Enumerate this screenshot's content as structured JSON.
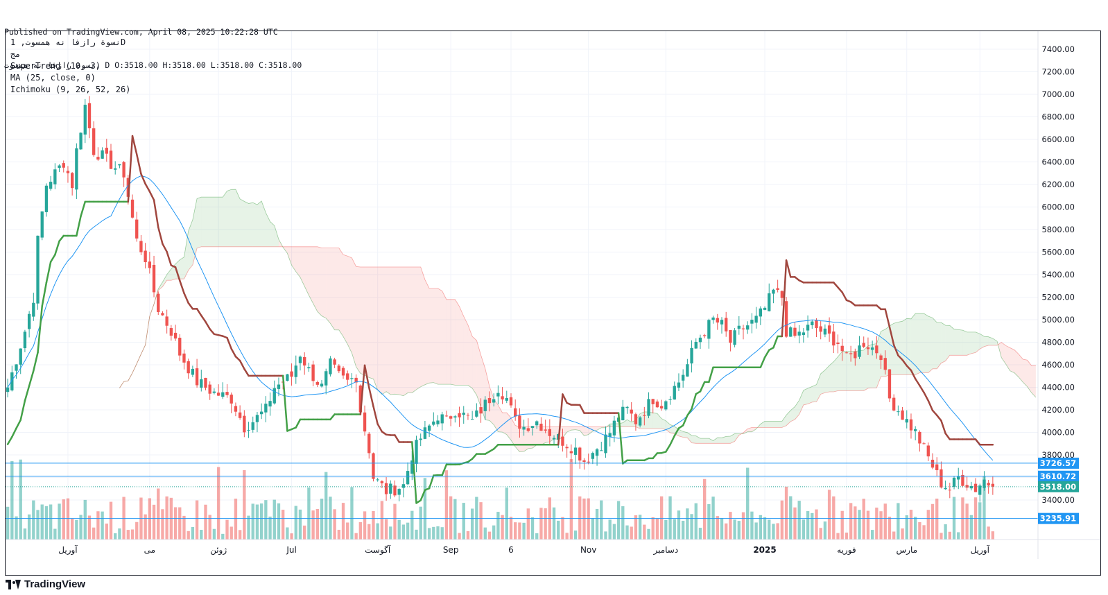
{
  "header": {
    "published": "Published on TradingView.com, April 08, 2025 10:22:28 UTC",
    "ohlc_line": "نسوة رازفا نه همسوت, D O:3518.00 H:3518.00 L:3518.00 C:3518.00"
  },
  "legend": {
    "symbol": "نسوة رازفا نه همسوت, 1D",
    "extra": "مج",
    "supertrend": "SuperTrend (10, 3)",
    "ma": "MA (25, close, 0)",
    "ichimoku": "Ichimoku (9, 26, 52, 26)"
  },
  "footer": {
    "logo_text": "TradingView"
  },
  "colors": {
    "up": "#26a69a",
    "down": "#ef5350",
    "supertrend_up": "#43a047",
    "supertrend_down": "#a0463e",
    "ma": "#2196f3",
    "cloud_up": "#43a047",
    "cloud_down": "#ef5350",
    "hline": "#2196f3",
    "last_price": "#26a69a"
  },
  "chart_data": {
    "type": "candlestick",
    "y_axis": {
      "min": 3200,
      "max": 7500,
      "scale": "linear",
      "ticks": [
        3400,
        3600,
        3800,
        4000,
        4200,
        4400,
        4600,
        4800,
        5000,
        5200,
        5400,
        5600,
        5800,
        6000,
        6200,
        6400,
        6600,
        6800,
        7000,
        7200,
        7400
      ],
      "tick_labels": [
        "3400.00",
        "3600.00",
        "3800.00",
        "4000.00",
        "4200.00",
        "4400.00",
        "4600.00",
        "4800.00",
        "5000.00",
        "5200.00",
        "5400.00",
        "5600.00",
        "5800.00",
        "6000.00",
        "6200.00",
        "6400.00",
        "6600.00",
        "6800.00",
        "7000.00",
        "7200.00",
        "7400.00"
      ]
    },
    "x_axis": {
      "labels": [
        {
          "text": "آوریل",
          "bar": 14
        },
        {
          "text": "می",
          "bar": 33
        },
        {
          "text": "ژوئن",
          "bar": 49
        },
        {
          "text": "Jul",
          "bar": 66
        },
        {
          "text": "آگوست",
          "bar": 86
        },
        {
          "text": "Sep",
          "bar": 103
        },
        {
          "text": "6",
          "bar": 117
        },
        {
          "text": "Nov",
          "bar": 135
        },
        {
          "text": "دسامبر",
          "bar": 153
        },
        {
          "text": "2025",
          "bar": 176
        },
        {
          "text": "فوریه",
          "bar": 195
        },
        {
          "text": "مارس",
          "bar": 209
        },
        {
          "text": "آوریل",
          "bar": 226
        }
      ]
    },
    "grid": true,
    "price_lines": [
      {
        "value": 3726.57,
        "label": "3726.57"
      },
      {
        "value": 3610.72,
        "label": "3610.72"
      },
      {
        "value": 3235.91,
        "label": "3235.91"
      }
    ],
    "last_price": {
      "value": 3518.0,
      "label": "3518.00"
    },
    "close_anchors": [
      [
        0,
        4400
      ],
      [
        2,
        4650
      ],
      [
        4,
        4900
      ],
      [
        6,
        5200
      ],
      [
        7,
        5700
      ],
      [
        9,
        6200
      ],
      [
        11,
        6300
      ],
      [
        13,
        6400
      ],
      [
        15,
        6200
      ],
      [
        16,
        6500
      ],
      [
        18,
        6900
      ],
      [
        20,
        6500
      ],
      [
        22,
        6450
      ],
      [
        25,
        6350
      ],
      [
        27,
        6300
      ],
      [
        29,
        5900
      ],
      [
        30,
        5700
      ],
      [
        32,
        5550
      ],
      [
        33,
        5400
      ],
      [
        35,
        5100
      ],
      [
        38,
        4900
      ],
      [
        40,
        4700
      ],
      [
        44,
        4450
      ],
      [
        48,
        4350
      ],
      [
        52,
        4300
      ],
      [
        55,
        4050
      ],
      [
        57,
        4100
      ],
      [
        60,
        4200
      ],
      [
        62,
        4400
      ],
      [
        64,
        4450
      ],
      [
        66,
        4500
      ],
      [
        68,
        4700
      ],
      [
        70,
        4550
      ],
      [
        73,
        4400
      ],
      [
        75,
        4600
      ],
      [
        77,
        4500
      ],
      [
        79,
        4450
      ],
      [
        81,
        4500
      ],
      [
        82,
        4200
      ],
      [
        84,
        3850
      ],
      [
        85,
        3600
      ],
      [
        88,
        3480
      ],
      [
        90,
        3500
      ],
      [
        92,
        3530
      ],
      [
        94,
        3800
      ],
      [
        96,
        3950
      ],
      [
        98,
        4050
      ],
      [
        100,
        4150
      ],
      [
        102,
        4100
      ],
      [
        104,
        4200
      ],
      [
        106,
        4150
      ],
      [
        108,
        4100
      ],
      [
        110,
        4200
      ],
      [
        112,
        4300
      ],
      [
        114,
        4400
      ],
      [
        116,
        4300
      ],
      [
        118,
        4100
      ],
      [
        120,
        4050
      ],
      [
        123,
        4100
      ],
      [
        126,
        4000
      ],
      [
        128,
        3950
      ],
      [
        130,
        3900
      ],
      [
        132,
        3850
      ],
      [
        134,
        3750
      ],
      [
        136,
        3820
      ],
      [
        138,
        3900
      ],
      [
        140,
        4000
      ],
      [
        142,
        4150
      ],
      [
        144,
        4200
      ],
      [
        146,
        4100
      ],
      [
        148,
        4200
      ],
      [
        150,
        4300
      ],
      [
        152,
        4250
      ],
      [
        154,
        4350
      ],
      [
        156,
        4450
      ],
      [
        158,
        4600
      ],
      [
        160,
        4800
      ],
      [
        162,
        4900
      ],
      [
        164,
        5000
      ],
      [
        166,
        4950
      ],
      [
        168,
        4800
      ],
      [
        170,
        4900
      ],
      [
        172,
        4950
      ],
      [
        174,
        5000
      ],
      [
        176,
        5100
      ],
      [
        178,
        5250
      ],
      [
        180,
        5200
      ],
      [
        181,
        4900
      ],
      [
        183,
        4850
      ],
      [
        185,
        4900
      ],
      [
        187,
        4950
      ],
      [
        189,
        4900
      ],
      [
        191,
        4850
      ],
      [
        193,
        4800
      ],
      [
        195,
        4650
      ],
      [
        197,
        4700
      ],
      [
        199,
        4800
      ],
      [
        201,
        4750
      ],
      [
        203,
        4700
      ],
      [
        205,
        4300
      ],
      [
        207,
        4200
      ],
      [
        209,
        4100
      ],
      [
        211,
        4000
      ],
      [
        213,
        3850
      ],
      [
        215,
        3700
      ],
      [
        217,
        3550
      ],
      [
        219,
        3500
      ],
      [
        221,
        3600
      ],
      [
        223,
        3550
      ],
      [
        225,
        3500
      ],
      [
        227,
        3580
      ],
      [
        229,
        3518
      ]
    ],
    "volume": {
      "max": 1.0
    }
  }
}
